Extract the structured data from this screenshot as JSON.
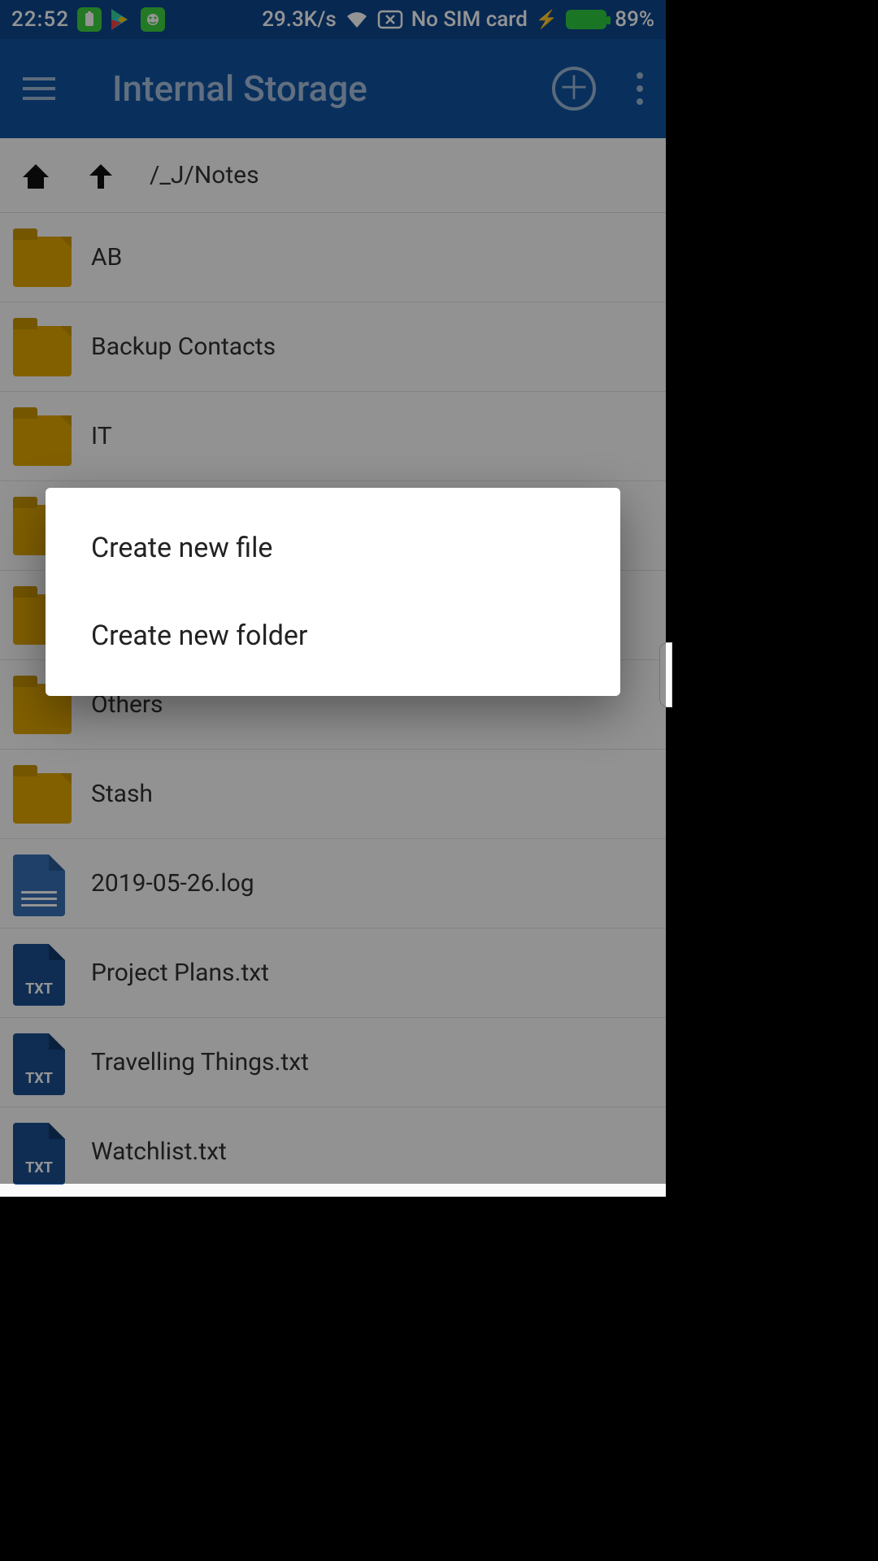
{
  "status": {
    "time": "22:52",
    "net_speed": "29.3K/s",
    "sim": "No SIM card",
    "battery_pct": "89%"
  },
  "appbar": {
    "title": "Internal Storage"
  },
  "breadcrumb": {
    "path": "/_J/Notes"
  },
  "files": [
    {
      "name": "AB",
      "type": "folder"
    },
    {
      "name": "Backup Contacts",
      "type": "folder"
    },
    {
      "name": "IT",
      "type": "folder"
    },
    {
      "name": "",
      "type": "folder"
    },
    {
      "name": "",
      "type": "folder"
    },
    {
      "name": "Others",
      "type": "folder"
    },
    {
      "name": "Stash",
      "type": "folder"
    },
    {
      "name": "2019-05-26.log",
      "type": "doc"
    },
    {
      "name": "Project Plans.txt",
      "type": "txt"
    },
    {
      "name": "Travelling Things.txt",
      "type": "txt"
    },
    {
      "name": "Watchlist.txt",
      "type": "txt"
    }
  ],
  "dialog": {
    "opt_file": "Create new file",
    "opt_folder": "Create new folder"
  },
  "txt_badge": "TXT"
}
